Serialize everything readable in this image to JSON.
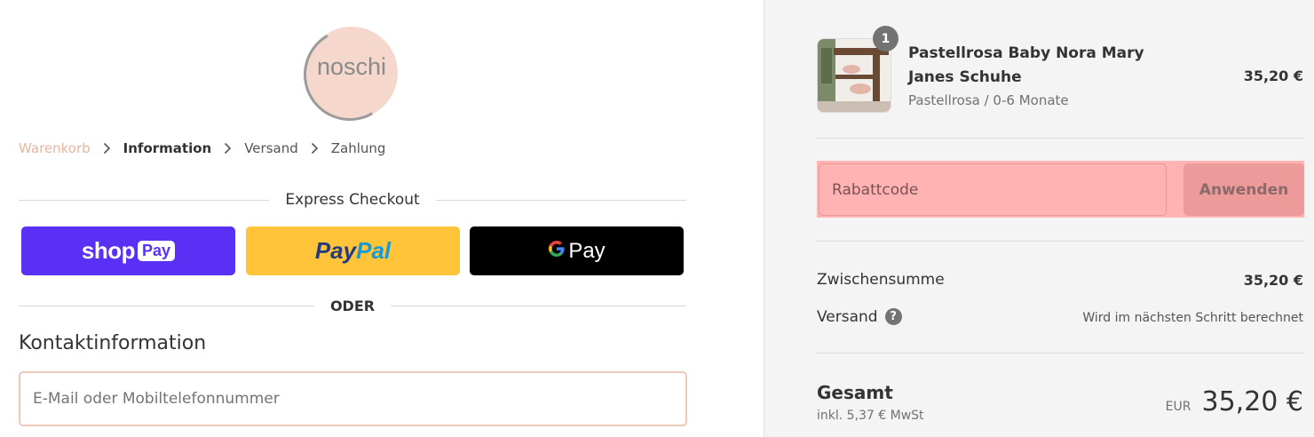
{
  "brand": {
    "logo_text": "noschi"
  },
  "breadcrumb": {
    "items": [
      "Warenkorb",
      "Information",
      "Versand",
      "Zahlung"
    ]
  },
  "express": {
    "title": "Express Checkout",
    "shop_pay": {
      "shop": "shop",
      "pay": "Pay"
    },
    "paypal": {
      "part1": "Pay",
      "part2": "Pal"
    },
    "gpay": {
      "g": "G",
      "pay": "Pay"
    },
    "or_label": "ODER"
  },
  "contact": {
    "title": "Kontaktinformation",
    "placeholder": "E-Mail oder Mobiltelefonnummer"
  },
  "cart": {
    "quantity": "1",
    "product_name": "Pastellrosa Baby Nora Mary Janes Schuhe",
    "variant": "Pastellrosa / 0-6 Monate",
    "price": "35,20 €"
  },
  "discount": {
    "placeholder": "Rabattcode",
    "apply_label": "Anwenden"
  },
  "summary": {
    "subtotal_label": "Zwischensumme",
    "subtotal_value": "35,20 €",
    "shipping_label": "Versand",
    "shipping_value": "Wird im nächsten Schritt berechnet",
    "total_label": "Gesamt",
    "tax_note": "inkl. 5,37 € MwSt",
    "currency": "EUR",
    "total_value": "35,20 €"
  },
  "colors": {
    "shop_pay": "#5a31f4",
    "paypal": "#ffc439",
    "gpay": "#000000",
    "discount_highlight": "#ffb3b3",
    "breadcrumb_first": "#e5b7a3"
  }
}
